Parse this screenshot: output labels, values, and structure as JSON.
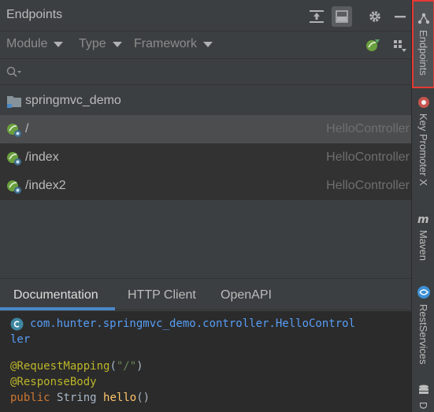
{
  "header": {
    "title": "Endpoints"
  },
  "filters": [
    {
      "label": "Module"
    },
    {
      "label": "Type"
    },
    {
      "label": "Framework"
    }
  ],
  "search": {
    "placeholder": ""
  },
  "tree": {
    "module_name": "springmvc_demo",
    "endpoints": [
      {
        "path": "/",
        "controller": "HelloController"
      },
      {
        "path": "/index",
        "controller": "HelloController"
      },
      {
        "path": "/index2",
        "controller": "HelloController"
      }
    ]
  },
  "bottom_tabs": [
    {
      "label": "Documentation"
    },
    {
      "label": "HTTP Client"
    },
    {
      "label": "OpenAPI"
    }
  ],
  "doc": {
    "class_line1": "com.hunter.springmvc_demo.controller.HelloControl",
    "class_line2": "ler",
    "annotation1_name": "@RequestMapping",
    "annotation1_open": "(",
    "annotation1_arg": "\"/\"",
    "annotation1_close": ")",
    "annotation2": "@ResponseBody",
    "method_kw": "public",
    "method_type": "String",
    "method_name": "hello",
    "method_parens": "()"
  },
  "side_tabs": [
    {
      "label": "Endpoints",
      "active": true
    },
    {
      "label": "Key Promoter X",
      "active": false
    },
    {
      "label": "Maven",
      "active": false
    },
    {
      "label": "RestServices",
      "active": false
    },
    {
      "label": "D",
      "active": false
    }
  ],
  "colors": {
    "background": "#3c3f41",
    "selected_row": "#4b4d4f",
    "doc_background": "#2b2b2b",
    "link_blue": "#589df6",
    "accent_underline": "#4a88c7",
    "active_tab_border": "#e53935"
  }
}
